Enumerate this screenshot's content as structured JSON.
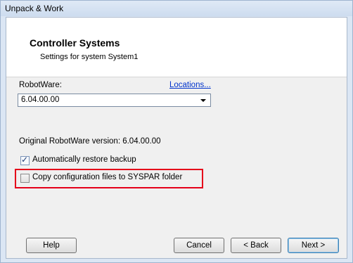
{
  "window": {
    "title": "Unpack & Work"
  },
  "header": {
    "title": "Controller Systems",
    "subtitle": "Settings for system System1"
  },
  "robotware": {
    "label": "RobotWare:",
    "locations_link": "Locations...",
    "selected_version": "6.04.00.00",
    "original_version_text": "Original RobotWare version: 6.04.00.00"
  },
  "options": [
    {
      "label": "Automatically restore backup",
      "checked": true
    },
    {
      "label": "Copy configuration files to SYSPAR folder",
      "checked": false
    }
  ],
  "buttons": {
    "help": "Help",
    "cancel": "Cancel",
    "back": "< Back",
    "next": "Next >"
  },
  "colors": {
    "highlight": "#e5001a",
    "link": "#0033cc"
  },
  "icons": {
    "dropdown": "chevron-down-icon",
    "check": "checkmark-icon"
  }
}
